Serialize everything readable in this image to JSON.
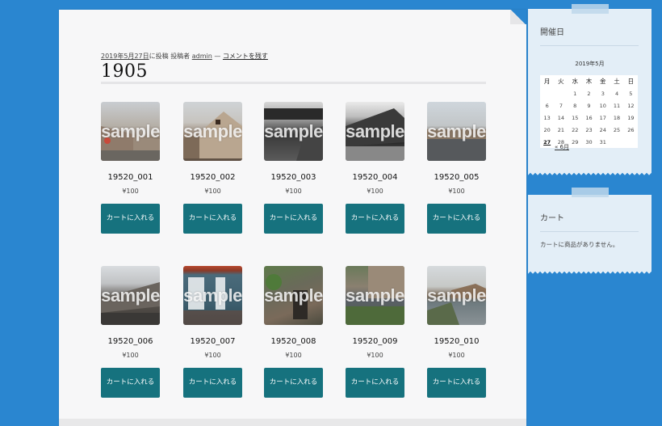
{
  "post": {
    "date": "2019年5月27日",
    "posted_on_suffix": "に投稿",
    "author_prefix": "投稿者",
    "author": "admin",
    "separator": "—",
    "comment_link": "コメントを残す",
    "title": "1905"
  },
  "products": [
    {
      "name": "19520_001",
      "price": "¥100",
      "button": "カートに入れる",
      "watermark": "sample"
    },
    {
      "name": "19520_002",
      "price": "¥100",
      "button": "カートに入れる",
      "watermark": "sample"
    },
    {
      "name": "19520_003",
      "price": "¥100",
      "button": "カートに入れる",
      "watermark": "sample"
    },
    {
      "name": "19520_004",
      "price": "¥100",
      "button": "カートに入れる",
      "watermark": "sample"
    },
    {
      "name": "19520_005",
      "price": "¥100",
      "button": "カートに入れる",
      "watermark": "sample"
    },
    {
      "name": "19520_006",
      "price": "¥100",
      "button": "カートに入れる",
      "watermark": "sample"
    },
    {
      "name": "19520_007",
      "price": "¥100",
      "button": "カートに入れる",
      "watermark": "sample"
    },
    {
      "name": "19520_008",
      "price": "¥100",
      "button": "カートに入れる",
      "watermark": "sample"
    },
    {
      "name": "19520_009",
      "price": "¥100",
      "button": "カートに入れる",
      "watermark": "sample"
    },
    {
      "name": "19520_010",
      "price": "¥100",
      "button": "カートに入れる",
      "watermark": "sample"
    }
  ],
  "sidebar": {
    "calendar_widget": {
      "title": "開催日",
      "caption": "2019年5月",
      "weekdays": [
        "月",
        "火",
        "水",
        "木",
        "金",
        "土",
        "日"
      ],
      "weeks": [
        [
          "",
          "",
          "1",
          "2",
          "3",
          "4",
          "5"
        ],
        [
          "6",
          "7",
          "8",
          "9",
          "10",
          "11",
          "12"
        ],
        [
          "13",
          "14",
          "15",
          "16",
          "17",
          "18",
          "19"
        ],
        [
          "20",
          "21",
          "22",
          "23",
          "24",
          "25",
          "26"
        ],
        [
          "27",
          "28",
          "29",
          "30",
          "31",
          "",
          ""
        ]
      ],
      "today": "27",
      "prev_link": "« 6月"
    },
    "cart_widget": {
      "title": "カート",
      "empty_message": "カートに商品がありません。"
    }
  },
  "colors": {
    "background": "#2a86d0",
    "button": "#16727e",
    "widget": "#e3eef7"
  }
}
